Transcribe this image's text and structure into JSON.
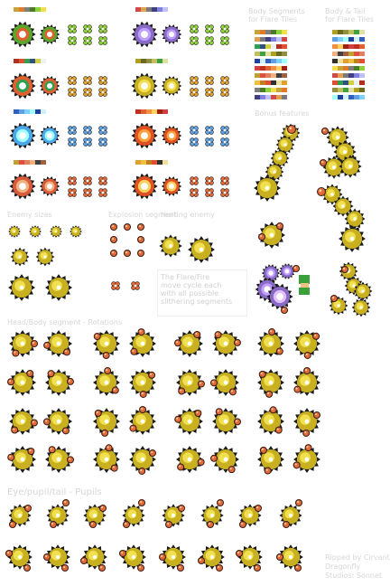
{
  "labels": {
    "body_segments_header": "Body Segments\nfor Flare Tiles",
    "body_tail_header": "Body & Tail\nfor Flare Tiles",
    "bonus_features": "Bonus features",
    "enemy_sizes": "Enemy sizes",
    "explosion_segment": "Explosion segment",
    "hurting_enemy": "Hurting enemy",
    "head_sheet": "Head/Body segment - Rotations",
    "eye_row_header": "Eye/pupil/tail - Pupils",
    "credit_line1": "Ripped by Cirvant",
    "credit_line2": "Dragonfly",
    "credit_line3": "Studios: Sonnet"
  },
  "notes": {
    "flare_note": "The Flare/Fire\nmove cycle each\nwith all possible\nslithering segments"
  },
  "palettes": {
    "top_left": [
      "#c9a23a",
      "#e07b2a",
      "#7f7f7f",
      "#4a7a2a",
      "#8fd13a",
      "#f2e04a"
    ],
    "top_mid": [
      "#d04a4a",
      "#e0a050",
      "#7a7a7a",
      "#404080",
      "#8080e0",
      "#c0c0ff"
    ],
    "row2_left": [
      "#b03020",
      "#e05030",
      "#30a050",
      "#305080",
      "#d0d040",
      "#f0f0f0"
    ],
    "row2_mid": [
      "#b0a020",
      "#6a6a20",
      "#909040",
      "#c0c060",
      "#40a040",
      "#e0e0a0"
    ],
    "row3_left": [
      "#3060c0",
      "#60a0e0",
      "#80d0ff",
      "#a0ffff",
      "#2040a0",
      "#d0f0ff"
    ],
    "row3_mid": [
      "#c03020",
      "#e06030",
      "#f09040",
      "#ffd060",
      "#a02010",
      "#d04040"
    ],
    "row4_left": [
      "#c0a030",
      "#e05040",
      "#e08060",
      "#f0b080",
      "#404040",
      "#a06040"
    ],
    "row4_mid": [
      "#e0a030",
      "#f0c040",
      "#c08020",
      "#e05030",
      "#303030",
      "#f0e0a0"
    ]
  },
  "colors": {
    "green_ring": "#5aa62a",
    "purple_ring": "#8a6ac8",
    "blue_ring": "#4aa8e8",
    "red_ring": "#d85a3a",
    "gold": "#c8b020",
    "gold_light": "#f0e050",
    "orange_petal": "#e06a3a",
    "link_green": "#3aa03a"
  }
}
